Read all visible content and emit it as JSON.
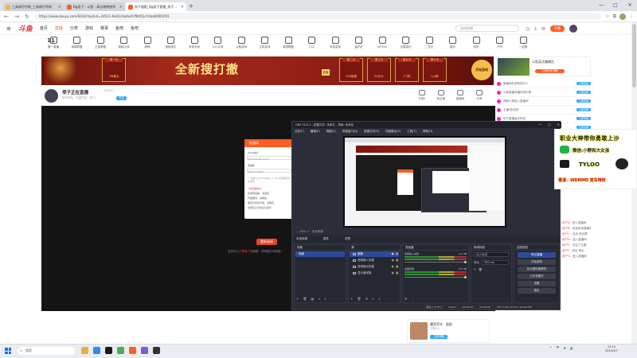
{
  "browser": {
    "tabs": [
      {
        "label": "工具神仔传新_工具神仔传新",
        "active": false,
        "color": "#f3b23a"
      },
      {
        "label": "Bg类子 - 斗鱼 - 高洁物种快传",
        "active": false,
        "color": "#ff5d23"
      },
      {
        "label": "坝子留影_Bg类子直播_坝子江记录",
        "active": true,
        "color": "#ff5d23"
      }
    ],
    "new_tab": "+",
    "url": "https://www.douyu.com/9419?dyshid=2d521-9a021da4a41f9bf01c10aa90001f01",
    "window_controls": [
      "—",
      "□",
      "✕"
    ]
  },
  "site": {
    "logo": "斗鱼",
    "nav": [
      {
        "label": "首页",
        "active": false
      },
      {
        "label": "直播",
        "active": true
      },
      {
        "label": "分类",
        "active": false
      },
      {
        "label": "游戏",
        "active": false
      },
      {
        "label": "赛事",
        "active": false
      },
      {
        "label": "鱼吧",
        "active": false
      },
      {
        "label": "鱼吧",
        "active": false
      }
    ],
    "search_placeholder": "游戏直播",
    "start_button": "开播",
    "schedule_day": "11",
    "categories": [
      "直播节目",
      "第一直播",
      "英雄联盟",
      "王者荣耀",
      "穿越火线",
      "原神",
      "绝地求生",
      "永劫无间",
      "LOL手游",
      "斗鱼游戏",
      "主机游戏",
      "英雄联盟",
      "CS2",
      "手机游戏",
      "金铲铲",
      "DOTA2",
      "无畏契约",
      "二次元",
      "娱乐",
      "科技",
      "户外",
      "一起看",
      "音乐",
      "体育",
      "颜值",
      "美食",
      "汽车"
    ]
  },
  "banner": {
    "title": "全新搜打撤",
    "badges": [
      {
        "top": "第一天",
        "main": "2W鱼丸"
      },
      {
        "top": "第二天",
        "main": "100鱼翅"
      },
      {
        "top": "第三天",
        "main": "50办卡"
      },
      {
        "top": "第五天",
        "main": "1飞机"
      },
      {
        "top": "第七天",
        "main": "1火箭"
      }
    ],
    "tag": "直播",
    "start_btn": "开始游戏"
  },
  "streamer": {
    "name": "坝子正在直播",
    "extra": "7823个",
    "sub": "坝子乐队 · 乐园节目 · 热门",
    "follow": "关注",
    "follow2": "订阅",
    "icons": [
      {
        "label": "乐园1",
        "name": "gift-icon"
      },
      {
        "label": "粉丝团",
        "name": "fan-icon"
      },
      {
        "label": "直播间",
        "name": "share-icon"
      },
      {
        "label": "分享",
        "name": "link-icon"
      }
    ]
  },
  "push_dialog": {
    "header": "推流码",
    "rtmp_label": "rtmp地址",
    "rtmp_value": "rtmp://sendtx1.douyu",
    "key_label": "直播码",
    "key_value": "9419rnxQU8DH",
    "tip": "1. 复制上方rtmp地址 2. rtmp直播码请勿泄露",
    "warn_title": "斗鱼直播中心",
    "lines": [
      "检测到直播，请连接",
      "开始推流，请稍后",
      "推流已成功开启，请保持",
      "关闭窗口可在后台运行"
    ]
  },
  "player": {
    "button": "重新连接",
    "notice_prefix": "您还可以",
    "notice_link": "下载客户端",
    "notice_suffix": "观看，获得更好体验哦~"
  },
  "obs": {
    "title": "OBS 30.0.2 - 配置文件: 未命名 - 场景: 未命名",
    "menu": [
      "文件(F)",
      "编辑(E)",
      "视图(V)",
      "停靠窗口(D)",
      "配置文件(P)",
      "场景集合(S)",
      "工具(T)",
      "帮助(H)"
    ],
    "preview_toolbar": "—  33%  +   ·   未选择源",
    "source_bar": [
      "未选择源",
      "属性",
      "滤镜"
    ],
    "scenes_title": "场景",
    "scenes": [
      "场景"
    ],
    "sources_title": "源",
    "sources": [
      {
        "label": "图像",
        "selected": true
      },
      {
        "label": "音频输入采集",
        "selected": false
      },
      {
        "label": "音频输出采集",
        "selected": false
      },
      {
        "label": "显示器采集",
        "selected": false
      }
    ],
    "mixer_title": "混音器",
    "mixer": [
      {
        "label": "音频输入采集",
        "db": "0.0 dB"
      },
      {
        "label": "桌面音频",
        "db": "0.0 dB"
      }
    ],
    "transitions_title": "转场特效",
    "transition_value": "淡入淡出",
    "duration_label": "时长",
    "duration_value": "300 ms",
    "controls_title": "控制按钮",
    "controls": [
      "停止直播",
      "开始录制",
      "启动虚拟摄像机",
      "工作室模式",
      "设置",
      "退出"
    ],
    "status": [
      "丢帧 0 (0.0%)",
      "0 kbps",
      "00:00:00",
      "00:00:00",
      "CPU: 0.8%, 60.00 / 60.00 FPS"
    ]
  },
  "watermark": {
    "line1": "职业大神带你勇敢上沙",
    "line2": "微信:小野和大女孩",
    "team": "TYLOO",
    "line3": "邀请：WDNMD 宽车特权"
  },
  "right_panel": {
    "promo_title": "斗鱼英文编辑台",
    "promo_btn": "立即前往领取",
    "items": [
      {
        "text": "直播间礼物特效达人",
        "btn": "立即查看"
      },
      {
        "text": "斗鱼直播间福利排行榜",
        "btn": "立即查看"
      },
      {
        "text": "神秘人物进入直播间",
        "btn": "立即查看"
      },
      {
        "text": "主播·粉丝团",
        "btn": "立即查看"
      },
      {
        "text": "坝子直播高光时刻",
        "btn": "立即查看"
      },
      {
        "text": "小坝子今日任务",
        "btn": "立即查看"
      },
      {
        "text": "坝子粉丝团",
        "btn": "立即查看"
      }
    ],
    "chat": [
      {
        "user": "用户A：",
        "msg": "进入直播间"
      },
      {
        "user": "用户B：",
        "msg": "欢迎来到直播间"
      },
      {
        "user": "用户C：",
        "msg": "送出 荧光棒"
      },
      {
        "user": "用户D：",
        "msg": "进入直播间"
      },
      {
        "user": "用户E：",
        "msg": "关注了主播"
      },
      {
        "user": "用户F：",
        "msg": "送出 鱼丸"
      },
      {
        "user": "用户G：",
        "msg": "进入直播间"
      }
    ]
  },
  "gift_card": {
    "title": "魔音荧光 · 鼓励",
    "sub": "已有2人",
    "btn": "立即领取"
  },
  "taskbar": {
    "search": "搜索",
    "apps": [
      "#e9b33a",
      "#2a8cf0",
      "#1a1a1a",
      "#4caf50",
      "#ff5d23",
      "#7b5cd6",
      "#333"
    ],
    "tray": [
      "^",
      "中",
      "⊕",
      "🔊"
    ],
    "time": "13:14",
    "date": "2024/4/7"
  }
}
